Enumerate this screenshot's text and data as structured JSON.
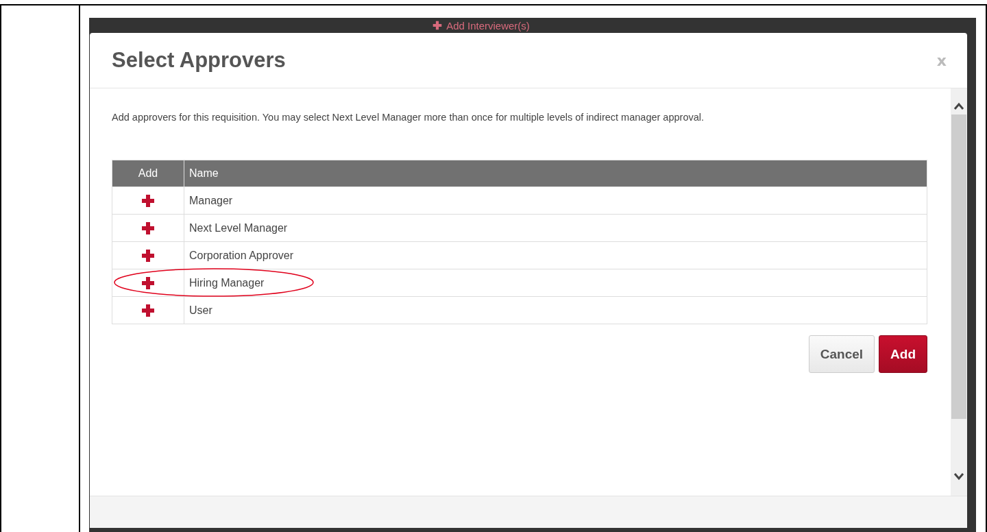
{
  "background": {
    "link": "Add Interviewer(s)"
  },
  "dialog": {
    "title": "Select Approvers",
    "close": "x",
    "intro": "Add approvers for this requisition. You may select Next Level Manager more than once for multiple levels of indirect manager approval.",
    "table": {
      "columns": [
        "Add",
        "Name"
      ],
      "rows": [
        {
          "name": "Manager",
          "circled": false
        },
        {
          "name": "Next Level Manager",
          "circled": false
        },
        {
          "name": "Corporation Approver",
          "circled": false
        },
        {
          "name": "Hiring Manager",
          "circled": true
        },
        {
          "name": "User",
          "circled": false
        }
      ]
    },
    "buttons": [
      {
        "label": "Cancel",
        "kind": "secondary"
      },
      {
        "label": "Add",
        "kind": "primary"
      }
    ]
  }
}
